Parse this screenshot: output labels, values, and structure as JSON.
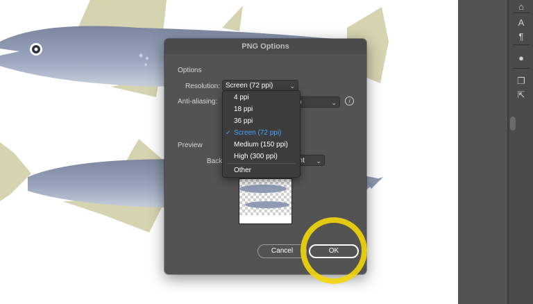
{
  "dialog": {
    "title": "PNG Options",
    "options_section": "Options",
    "resolution_label": "Resolution:",
    "resolution_value": "Screen (72 ppi)",
    "antialiasing_label": "Anti-aliasing:",
    "antialiasing_value_partial": ")",
    "preview_section": "Preview",
    "background_label_partial": "Backg",
    "background_value_partial": "ent",
    "cancel_label": "Cancel",
    "ok_label": "OK"
  },
  "resolution_menu": {
    "items": [
      "4 ppi",
      "18 ppi",
      "36 ppi",
      "Screen (72 ppi)",
      "Medium (150 ppi)",
      "High (300 ppi)",
      "Other"
    ],
    "selected": "Screen (72 ppi)"
  },
  "icons": {
    "info": "i",
    "chevron": "⌄",
    "check": "✓"
  },
  "colors": {
    "dialog_bg": "#535353",
    "menu_bg": "#3c3c3c",
    "selected_item": "#4aa3ff",
    "highlight_ring": "#f4d60a",
    "fish_body": "#8f9bb4",
    "fin": "#d6d3b0"
  }
}
